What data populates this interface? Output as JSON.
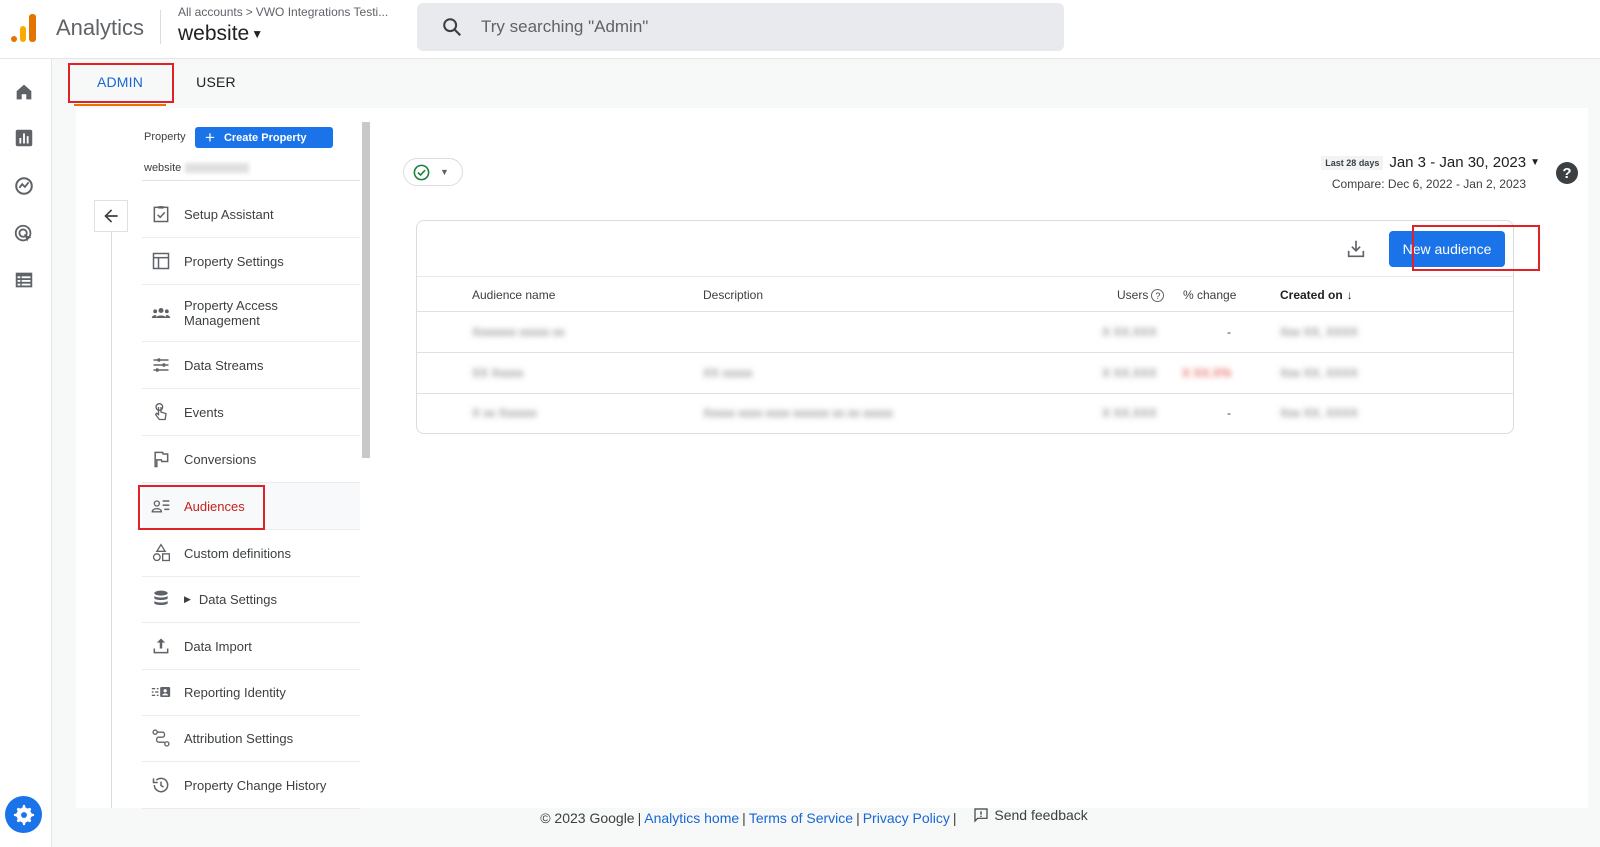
{
  "app": {
    "title": "Analytics"
  },
  "header": {
    "breadcrumb": {
      "root": "All accounts",
      "account": "VWO Integrations Testi..."
    },
    "property": "website"
  },
  "search": {
    "placeholder": "Try searching \"Admin\""
  },
  "tabs": [
    {
      "label": "ADMIN",
      "active": true
    },
    {
      "label": "USER",
      "active": false
    }
  ],
  "property_panel": {
    "property_label": "Property",
    "create_button": "Create Property",
    "property_value": "website"
  },
  "nav": {
    "items": [
      {
        "label": "Setup Assistant",
        "icon": "checklist-icon"
      },
      {
        "label": "Property Settings",
        "icon": "property-settings-icon"
      },
      {
        "label": "Property Access Management",
        "icon": "people-icon"
      },
      {
        "label": "Data Streams",
        "icon": "data-streams-icon"
      },
      {
        "label": "Events",
        "icon": "touch-icon"
      },
      {
        "label": "Conversions",
        "icon": "flag-icon"
      },
      {
        "label": "Audiences",
        "icon": "audience-icon",
        "active": true
      },
      {
        "label": "Custom definitions",
        "icon": "shapes-icon"
      },
      {
        "label": "Data Settings",
        "icon": "database-icon"
      },
      {
        "label": "Data Import",
        "icon": "upload-icon"
      },
      {
        "label": "Reporting Identity",
        "icon": "identity-icon"
      },
      {
        "label": "Attribution Settings",
        "icon": "attribution-icon"
      },
      {
        "label": "Property Change History",
        "icon": "history-icon"
      }
    ]
  },
  "date": {
    "tag": "Last 28 days",
    "range": "Jan 3 - Jan 30, 2023",
    "compare": "Compare: Dec 6, 2022 - Jan 2, 2023"
  },
  "table": {
    "new_button": "New audience",
    "columns": {
      "name": "Audience name",
      "description": "Description",
      "users": "Users",
      "change": "% change",
      "created": "Created on"
    },
    "rows": [
      {
        "name": "Xxxxxxx xxxxx xx",
        "description": "",
        "users": "X XX.XXX",
        "change": "-",
        "created": "Xxx XX, XXXX"
      },
      {
        "name": "XX Xxxxx",
        "description": "XX xxxxx",
        "users": "X XX.XXX",
        "change": "X XX.X%",
        "created": "Xxx XX, XXXX"
      },
      {
        "name": "X xx Xxxxxx",
        "description": "Xxxxx xxxx xxxx xxxxxx xx xx xxxxx",
        "users": "X XX.XXX",
        "change": "-",
        "created": "Xxx XX, XXXX"
      }
    ]
  },
  "footer": {
    "copyright": "© 2023 Google",
    "links": [
      "Analytics home",
      "Terms of Service",
      "Privacy Policy"
    ],
    "feedback": "Send feedback"
  },
  "colors": {
    "accent": "#1a73e8",
    "highlight": "#e12128",
    "tab_underline": "#e37400"
  }
}
